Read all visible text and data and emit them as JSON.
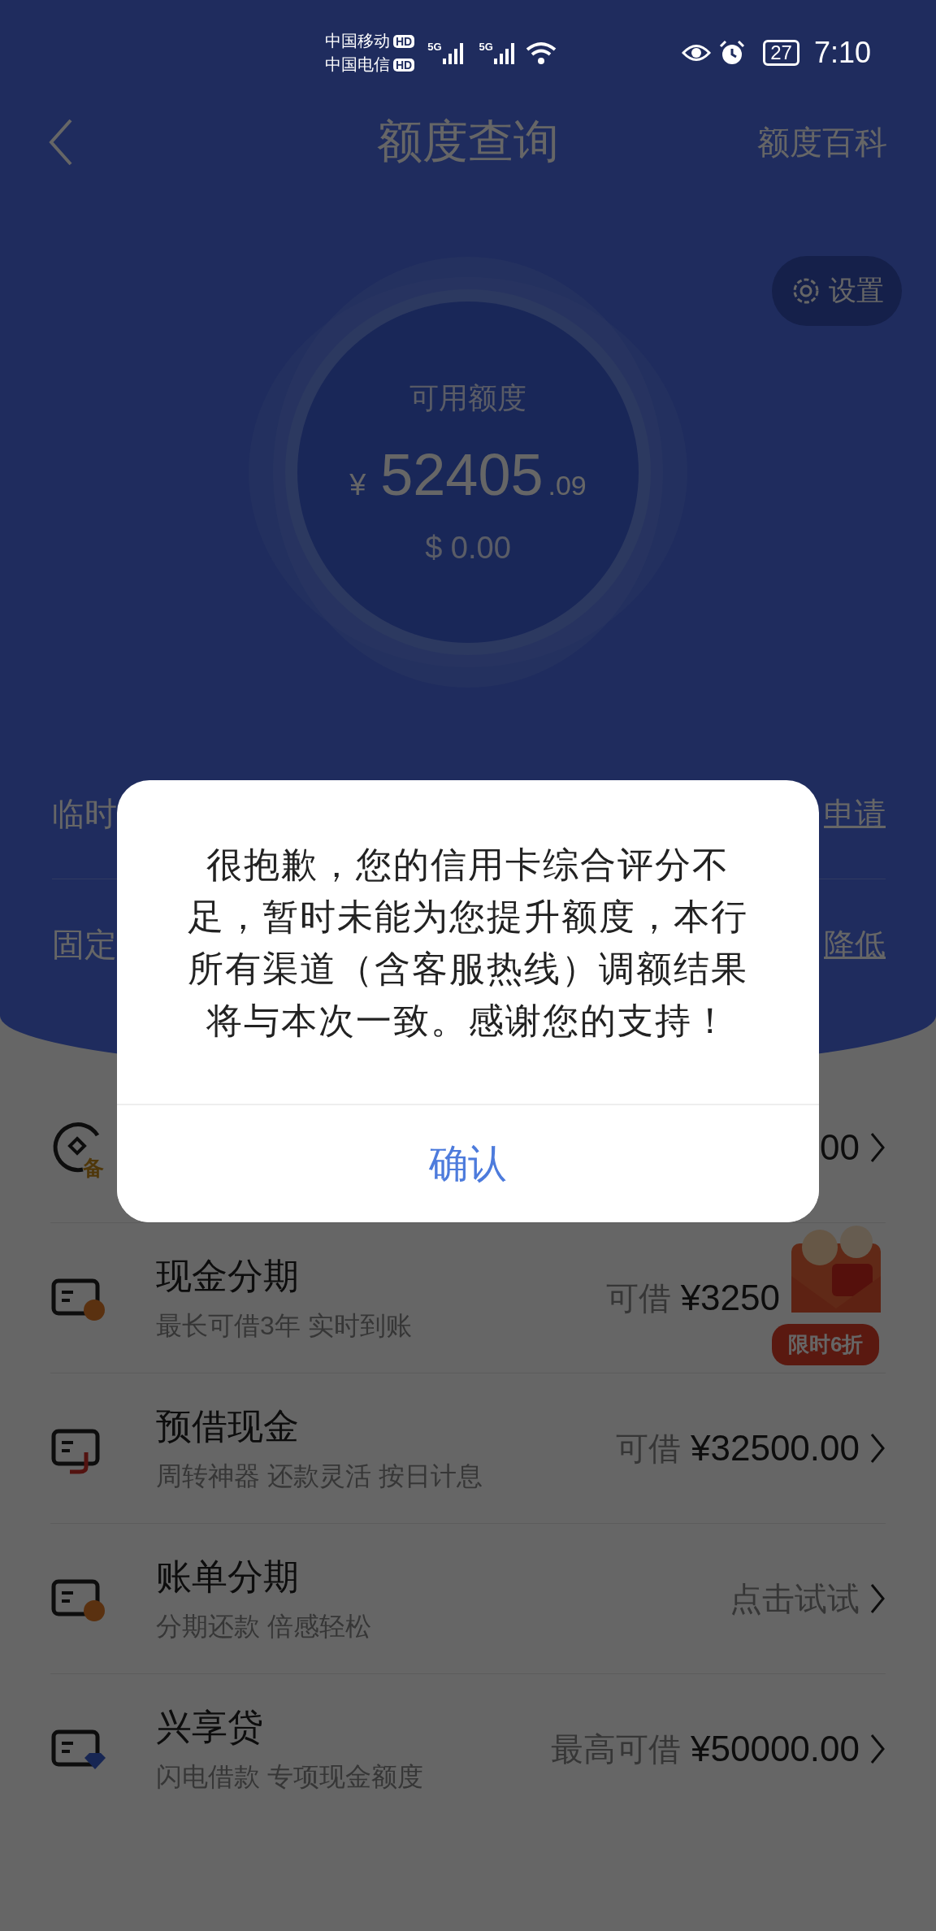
{
  "status_bar": {
    "carriers": [
      "中国移动",
      "中国电信"
    ],
    "hd": [
      "HD",
      "HD"
    ],
    "network": [
      "5G",
      "5G"
    ],
    "battery": "27",
    "time": "7:10"
  },
  "header": {
    "title": "额度查询",
    "action": "额度百科"
  },
  "settings_button": {
    "label": "设置"
  },
  "limit": {
    "label": "可用额度",
    "currency": "¥",
    "integer": "52405",
    "decimal": ".09",
    "usd": "$ 0.00"
  },
  "adjust_rows": [
    {
      "label": "临时",
      "action": "申请"
    },
    {
      "label": "固定",
      "action": "降低"
    }
  ],
  "services": [
    {
      "kind": "coin",
      "icon_badge": "备",
      "value": "00",
      "chevron": true
    },
    {
      "kind": "clock",
      "title": "现金分期",
      "subtitle": "最长可借3年 实时到账",
      "value_prefix": "可借",
      "value": "¥3250",
      "chevron": false
    },
    {
      "kind": "hook",
      "title": "预借现金",
      "subtitle": "周转神器 还款灵活 按日计息",
      "value_prefix": "可借",
      "value": "¥32500.00",
      "chevron": true
    },
    {
      "kind": "clock",
      "title": "账单分期",
      "subtitle": "分期还款 倍感轻松",
      "value_prefix": "点击试试",
      "chevron": true
    },
    {
      "kind": "gem",
      "title": "兴享贷",
      "subtitle": "闪电借款 专项现金额度",
      "value_prefix": "最高可借",
      "value": "¥50000.00",
      "chevron": true
    }
  ],
  "promo_badge": {
    "label": "限时6折"
  },
  "dialog": {
    "message": "很抱歉，您的信用卡综合评分不足，暂时未能为您提升额度，本行所有渠道（含客服热线）调额结果将与本次一致。感谢您的支持！",
    "confirm": "确认"
  }
}
